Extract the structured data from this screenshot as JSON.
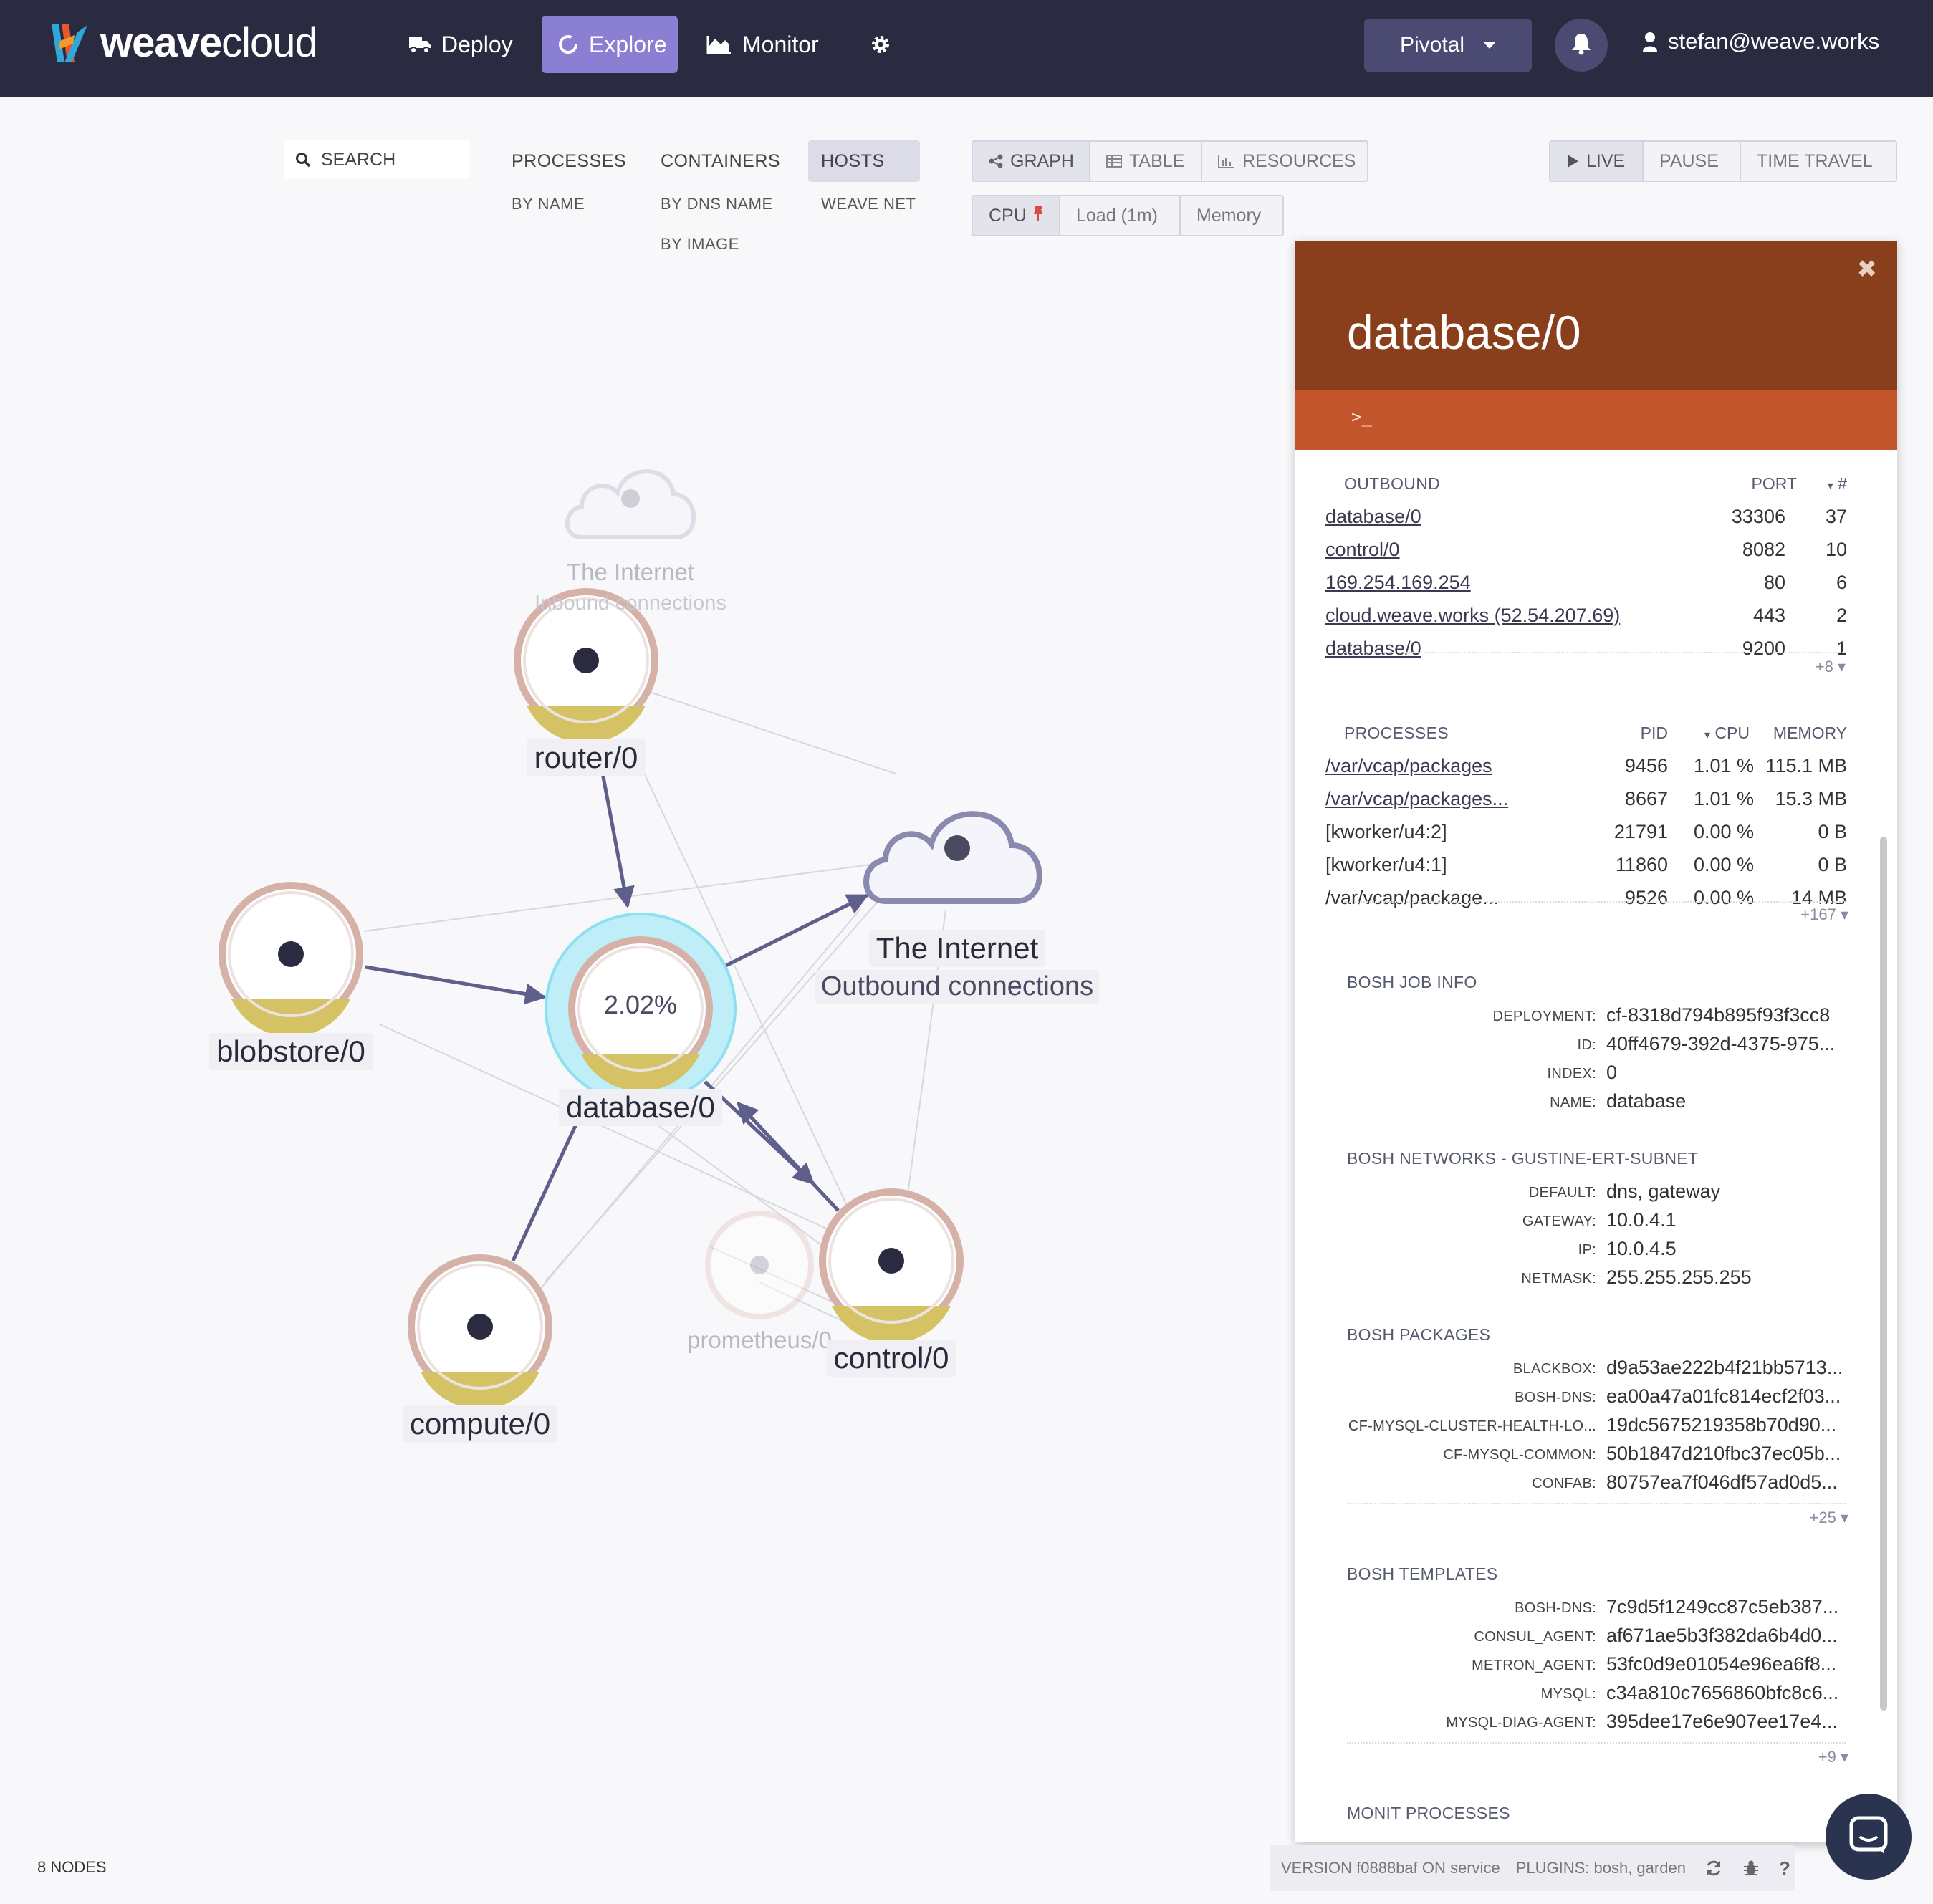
{
  "app": {
    "logo_text_bold": "weave",
    "logo_text_light": "cloud",
    "nav": {
      "deploy": "Deploy",
      "explore": "Explore",
      "monitor": "Monitor"
    },
    "org": "Pivotal",
    "user": "stefan@weave.works"
  },
  "toolbar": {
    "search_label": "SEARCH",
    "topologies": {
      "processes": "PROCESSES",
      "processes_by_name": "BY NAME",
      "containers": "CONTAINERS",
      "containers_by_dns": "BY DNS NAME",
      "containers_by_image": "BY IMAGE",
      "hosts": "HOSTS",
      "weave_net": "WEAVE NET"
    },
    "views": {
      "graph": "GRAPH",
      "table": "TABLE",
      "resources": "RESOURCES"
    },
    "metrics": {
      "cpu": "CPU",
      "load": "Load (1m)",
      "memory": "Memory"
    },
    "time": {
      "live": "LIVE",
      "pause": "PAUSE",
      "time_travel": "TIME TRAVEL"
    },
    "selected_topology": "HOSTS",
    "selected_view": "GRAPH",
    "selected_metric": "CPU",
    "selected_time": "LIVE"
  },
  "graph": {
    "nodes": [
      {
        "id": "internet-faded",
        "label": "The Internet",
        "sublabel": "Inbound connections",
        "faded": true,
        "shape": "cloud"
      },
      {
        "id": "router",
        "label": "router/0",
        "shape": "circle",
        "fill_level": 0.1
      },
      {
        "id": "internet",
        "label": "The Internet",
        "sublabel": "Outbound connections",
        "shape": "cloud"
      },
      {
        "id": "blobstore",
        "label": "blobstore/0",
        "shape": "circle",
        "fill_level": 0.1
      },
      {
        "id": "database",
        "label": "database/0",
        "metric": "2.02%",
        "shape": "circle",
        "selected": true,
        "fill_level": 0.1
      },
      {
        "id": "prometheus",
        "label": "prometheus/0",
        "shape": "circle",
        "faded": true
      },
      {
        "id": "control",
        "label": "control/0",
        "shape": "circle",
        "fill_level": 0.1
      },
      {
        "id": "compute",
        "label": "compute/0",
        "shape": "circle",
        "fill_level": 0.1
      }
    ],
    "colors": {
      "edge": "#5f5f8c",
      "node_ring": "#d5b1a8",
      "cpu_fill": "#d4c264",
      "selection": "#bfeef8"
    }
  },
  "details": {
    "title": "database/0",
    "terminal_icon": ">_",
    "outbound": {
      "title": "OUTBOUND",
      "col_port": "PORT",
      "col_count": "#",
      "rows": [
        {
          "name": "database/0",
          "port": "33306",
          "count": "37"
        },
        {
          "name": "control/0",
          "port": "8082",
          "count": "10"
        },
        {
          "name": "169.254.169.254",
          "port": "80",
          "count": "6"
        },
        {
          "name": "cloud.weave.works (52.54.207.69)",
          "port": "443",
          "count": "2"
        },
        {
          "name": "database/0",
          "port": "9200",
          "count": "1"
        }
      ],
      "more": "+8"
    },
    "processes": {
      "title": "PROCESSES",
      "col_pid": "PID",
      "col_cpu": "CPU",
      "col_memory": "MEMORY",
      "rows": [
        {
          "name": "/var/vcap/packages",
          "pid": "9456",
          "cpu": "1.01 %",
          "memory": "115.1 MB",
          "link": true
        },
        {
          "name": "/var/vcap/packages...",
          "pid": "8667",
          "cpu": "1.01 %",
          "memory": "15.3 MB",
          "link": true
        },
        {
          "name": "[kworker/u4:2]",
          "pid": "21791",
          "cpu": "0.00 %",
          "memory": "0 B",
          "link": false
        },
        {
          "name": "[kworker/u4:1]",
          "pid": "11860",
          "cpu": "0.00 %",
          "memory": "0 B",
          "link": false
        },
        {
          "name": "/var/vcap/package...",
          "pid": "9526",
          "cpu": "0.00 %",
          "memory": "14 MB",
          "link": false
        }
      ],
      "more": "+167"
    },
    "bosh_job": {
      "title": "BOSH JOB INFO",
      "rows": [
        {
          "key": "DEPLOYMENT:",
          "value": "cf-8318d794b895f93f3cc8"
        },
        {
          "key": "ID:",
          "value": "40ff4679-392d-4375-975..."
        },
        {
          "key": "INDEX:",
          "value": "0"
        },
        {
          "key": "NAME:",
          "value": "database"
        }
      ]
    },
    "bosh_networks": {
      "title": "BOSH NETWORKS - GUSTINE-ERT-SUBNET",
      "rows": [
        {
          "key": "DEFAULT:",
          "value": "dns, gateway"
        },
        {
          "key": "GATEWAY:",
          "value": "10.0.4.1"
        },
        {
          "key": "IP:",
          "value": "10.0.4.5"
        },
        {
          "key": "NETMASK:",
          "value": "255.255.255.255"
        }
      ]
    },
    "bosh_packages": {
      "title": "BOSH PACKAGES",
      "rows": [
        {
          "key": "BLACKBOX:",
          "value": "d9a53ae222b4f21bb5713..."
        },
        {
          "key": "BOSH-DNS:",
          "value": "ea00a47a01fc814ecf2f03..."
        },
        {
          "key": "CF-MYSQL-CLUSTER-HEALTH-LO...",
          "value": "19dc5675219358b70d90..."
        },
        {
          "key": "CF-MYSQL-COMMON:",
          "value": "50b1847d210fbc37ec05b..."
        },
        {
          "key": "CONFAB:",
          "value": "80757ea7f046df57ad0d5..."
        }
      ],
      "more": "+25"
    },
    "bosh_templates": {
      "title": "BOSH TEMPLATES",
      "rows": [
        {
          "key": "BOSH-DNS:",
          "value": "7c9d5f1249cc87c5eb387..."
        },
        {
          "key": "CONSUL_AGENT:",
          "value": "af671ae5b3f382da6b4d0..."
        },
        {
          "key": "METRON_AGENT:",
          "value": "53fc0d9e01054e96ea6f8..."
        },
        {
          "key": "MYSQL:",
          "value": "c34a810c7656860bfc8c6..."
        },
        {
          "key": "MYSQL-DIAG-AGENT:",
          "value": "395dee17e6e907ee17e4..."
        }
      ],
      "more": "+9"
    },
    "monit_title": "MONIT PROCESSES",
    "colors": {
      "header": "#8a3f1c",
      "toolbar": "#c2552a"
    }
  },
  "footer": {
    "nodes_count": "8 NODES",
    "version": "VERSION f0888baf ON service",
    "plugins": "PLUGINS: bosh, garden"
  }
}
